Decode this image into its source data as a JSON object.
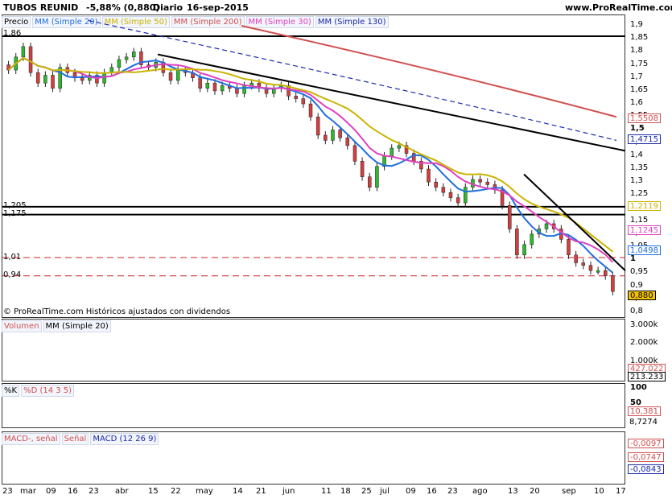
{
  "header": {
    "ticker": "TUBOS REUNID",
    "change": "-5,88% (0,880)",
    "period": "Diario",
    "date": "16-sep-2015",
    "site": "www.ProRealTime.com"
  },
  "price_legend": [
    {
      "label": "Precio",
      "color": "#000000"
    },
    {
      "label": "MM (Simple 20)",
      "color": "#1f6fe0"
    },
    {
      "label": "MM (Simple 50)",
      "color": "#c9b400"
    },
    {
      "label": "MM (Simple 200)",
      "color": "#d05050"
    },
    {
      "label": "MM (Simple 30)",
      "color": "#e040c0"
    },
    {
      "label": "MM (Simple 130)",
      "color": "#1a2aa8"
    }
  ],
  "copyright": "© ProRealTime.com Históricos ajustados con dividendos",
  "level_labels": [
    "1,86",
    "1,205",
    "1,175",
    "1,01",
    "0,94"
  ],
  "price_axis": [
    "1,9",
    "1,85",
    "1,8",
    "1,75",
    "1,7",
    "1,65",
    "1,6",
    "1,55",
    "1,5",
    "1,45",
    "1,4",
    "1,35",
    "1,3",
    "1,25",
    "1,2",
    "1,15",
    "1,1",
    "1,05",
    "1",
    "0,95",
    "0,9",
    "0,85",
    "0,8"
  ],
  "price_tags": [
    {
      "value": "1,5508",
      "color": "#d05050"
    },
    {
      "value": "1,4715",
      "color": "#1a2aa8"
    },
    {
      "value": "1,2119",
      "color": "#c9b400"
    },
    {
      "value": "1,1245",
      "color": "#e040c0"
    },
    {
      "value": "1,0498",
      "color": "#1f6fe0"
    },
    {
      "value": "0,880",
      "color": "#000000"
    }
  ],
  "volume_legend": [
    {
      "label": "Volumen",
      "color": "#d05050"
    },
    {
      "label": "MM (Simple 20)",
      "color": "#000000"
    }
  ],
  "volume_axis": [
    "3.000k",
    "2.000k",
    "1.000k"
  ],
  "volume_tags": [
    {
      "value": "427.022",
      "color": "#d05050"
    },
    {
      "value": "213.233",
      "color": "#000000"
    }
  ],
  "stoch_legend": [
    {
      "label": "%K",
      "color": "#000000"
    },
    {
      "label": "%D (14 3 5)",
      "color": "#d05050"
    }
  ],
  "stoch_axis": [
    "100",
    "50",
    "0"
  ],
  "stoch_tags": [
    {
      "value": "10,381",
      "color": "#d05050"
    },
    {
      "value": "8,7274",
      "color": "#000000"
    }
  ],
  "macd_legend": [
    {
      "label": "MACD-, señal",
      "color": "#d05050"
    },
    {
      "label": "Señal",
      "color": "#d05050"
    },
    {
      "label": "MACD (12 26 9)",
      "color": "#1a2aa8"
    }
  ],
  "macd_tags": [
    {
      "value": "-0,0097",
      "color": "#d05050"
    },
    {
      "value": "-0,0747",
      "color": "#d05050"
    },
    {
      "value": "-0,0843",
      "color": "#1a2aa8"
    }
  ],
  "x_axis": [
    "23",
    "mar",
    "09",
    "16",
    "23",
    "abr",
    "15",
    "22",
    "may",
    "14",
    "21",
    "jun",
    "11",
    "18",
    "25",
    "jul",
    "09",
    "16",
    "23",
    "ago",
    "13",
    "20",
    "sep",
    "10",
    "17"
  ],
  "chart_data": {
    "type": "candlestick",
    "title": "TUBOS REUNID Diario 16-sep-2015",
    "ylim": [
      0.8,
      1.9
    ],
    "support_resistance": [
      1.86,
      1.205,
      1.175,
      1.01,
      0.94
    ],
    "closes": [
      1.73,
      1.78,
      1.82,
      1.72,
      1.68,
      1.71,
      1.66,
      1.74,
      1.72,
      1.7,
      1.69,
      1.71,
      1.68,
      1.72,
      1.74,
      1.77,
      1.78,
      1.8,
      1.75,
      1.74,
      1.76,
      1.72,
      1.69,
      1.73,
      1.72,
      1.7,
      1.66,
      1.68,
      1.65,
      1.67,
      1.66,
      1.64,
      1.67,
      1.68,
      1.66,
      1.64,
      1.66,
      1.67,
      1.63,
      1.62,
      1.6,
      1.55,
      1.48,
      1.46,
      1.5,
      1.47,
      1.44,
      1.38,
      1.32,
      1.28,
      1.36,
      1.4,
      1.43,
      1.44,
      1.41,
      1.38,
      1.35,
      1.3,
      1.28,
      1.26,
      1.24,
      1.22,
      1.28,
      1.31,
      1.3,
      1.29,
      1.27,
      1.21,
      1.12,
      1.02,
      1.06,
      1.1,
      1.12,
      1.14,
      1.12,
      1.08,
      1.02,
      0.99,
      0.98,
      0.96,
      0.96,
      0.94,
      0.88
    ],
    "ma20_last": 1.0498,
    "ma30_last": 1.1245,
    "ma50_last": 1.2119,
    "ma130_last": 1.4715,
    "ma200_last": 1.5508,
    "volume_last": 427022,
    "volume_ma20_last": 213233,
    "stoch_k_last": 8.7274,
    "stoch_d_last": 10.381,
    "macd_last": -0.0843,
    "macd_signal_last": -0.0747,
    "macd_hist_last": -0.0097
  }
}
